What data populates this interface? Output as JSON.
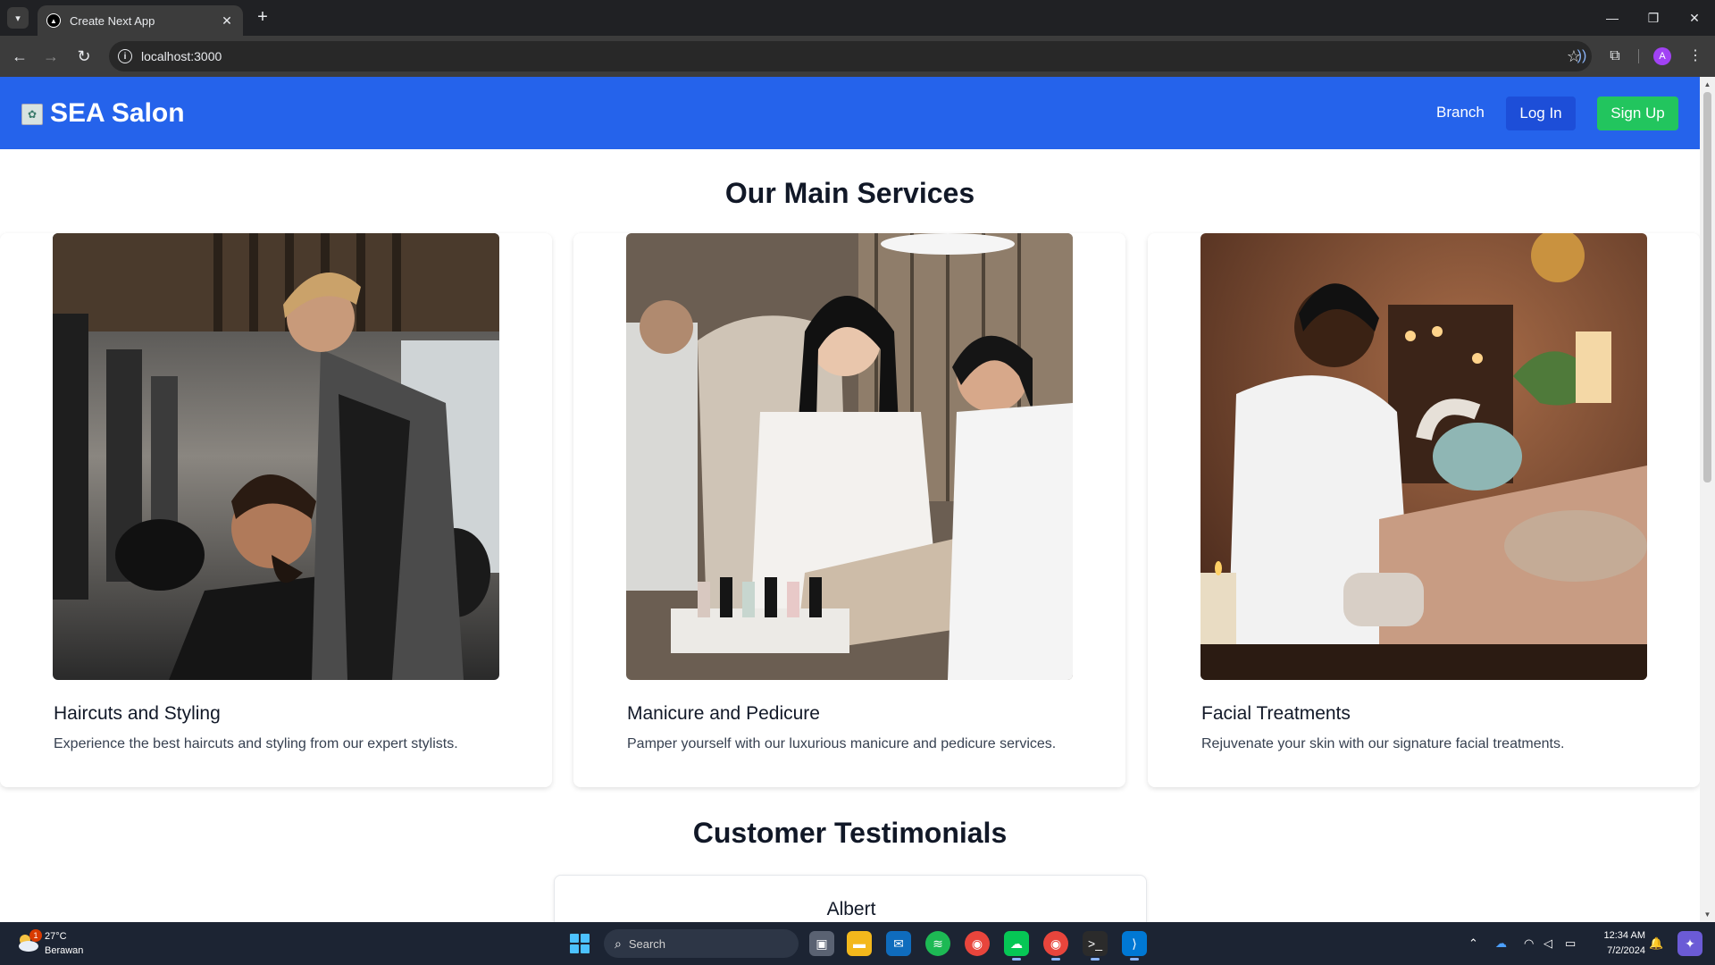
{
  "browser": {
    "tab_title": "Create Next App",
    "url": "localhost:3000",
    "profile_initial": "A"
  },
  "site": {
    "brand": "SEA Salon",
    "nav": {
      "branch_label": "Branch",
      "login_label": "Log In",
      "signup_label": "Sign Up"
    },
    "colors": {
      "nav_bg": "#2563eb",
      "login_bg": "#1d4ed8",
      "signup_bg": "#22c55e"
    }
  },
  "services": {
    "title": "Our Main Services",
    "items": [
      {
        "title": "Haircuts and Styling",
        "description": "Experience the best haircuts and styling from our expert stylists.",
        "image": "barber-photo"
      },
      {
        "title": "Manicure and Pedicure",
        "description": "Pamper yourself with our luxurious manicure and pedicure services.",
        "image": "manicure-photo"
      },
      {
        "title": "Facial Treatments",
        "description": "Rejuvenate your skin with our signature facial treatments.",
        "image": "facial-photo"
      }
    ]
  },
  "testimonials": {
    "title": "Customer Testimonials",
    "items": [
      {
        "name": "Albert"
      }
    ]
  },
  "taskbar": {
    "weather_temp": "27°C",
    "weather_desc": "Berawan",
    "weather_badge": "1",
    "search_placeholder": "Search",
    "time": "12:34 AM",
    "date": "7/2/2024"
  }
}
